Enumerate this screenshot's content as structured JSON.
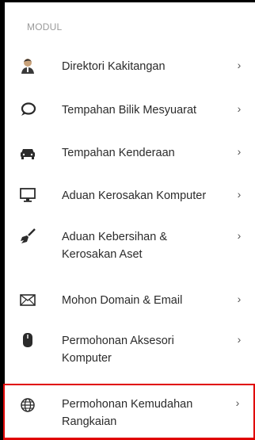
{
  "section_title": "MODUL",
  "menu": {
    "items": [
      {
        "label": "Direktori Kakitangan",
        "icon": "person-icon"
      },
      {
        "label": "Tempahan Bilik Mesyuarat",
        "icon": "speech-bubble-icon"
      },
      {
        "label": "Tempahan Kenderaan",
        "icon": "car-icon"
      },
      {
        "label": "Aduan Kerosakan Komputer",
        "icon": "desktop-icon"
      },
      {
        "label": "Aduan Kebersihan & Kerosakan Aset",
        "icon": "broom-icon"
      },
      {
        "label": "Mohon Domain & Email",
        "icon": "envelope-icon"
      },
      {
        "label": "Permohonan Aksesori Komputer",
        "icon": "mouse-icon"
      },
      {
        "label": "Permohonan Kemudahan Rangkaian",
        "icon": "globe-icon"
      }
    ],
    "chevron": "›",
    "selected_index": 7
  },
  "colors": {
    "selected_border": "#e00000",
    "section_label": "#9a9a9a"
  }
}
